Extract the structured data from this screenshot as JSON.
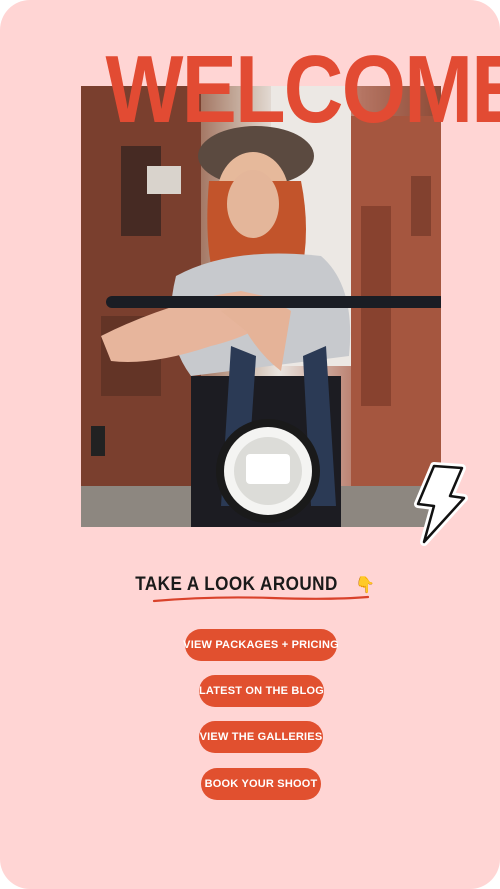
{
  "hero": {
    "heading": "WELCOME",
    "photo_description_icon": "photo-woman-motorbike",
    "bolt_icon": "lightning-bolt-icon"
  },
  "section": {
    "title": "TAKE A LOOK AROUND",
    "pointer_emoji": "👇"
  },
  "nav": {
    "buttons": [
      {
        "label": "VIEW PACKAGES + PRICING"
      },
      {
        "label": "LATEST ON THE BLOG"
      },
      {
        "label": "VIEW THE GALLERIES"
      },
      {
        "label": "BOOK YOUR SHOOT"
      }
    ]
  },
  "colors": {
    "background": "#ffd5d4",
    "accent": "#e1502f",
    "heading": "#e24b33",
    "text": "#1a1a1a"
  }
}
